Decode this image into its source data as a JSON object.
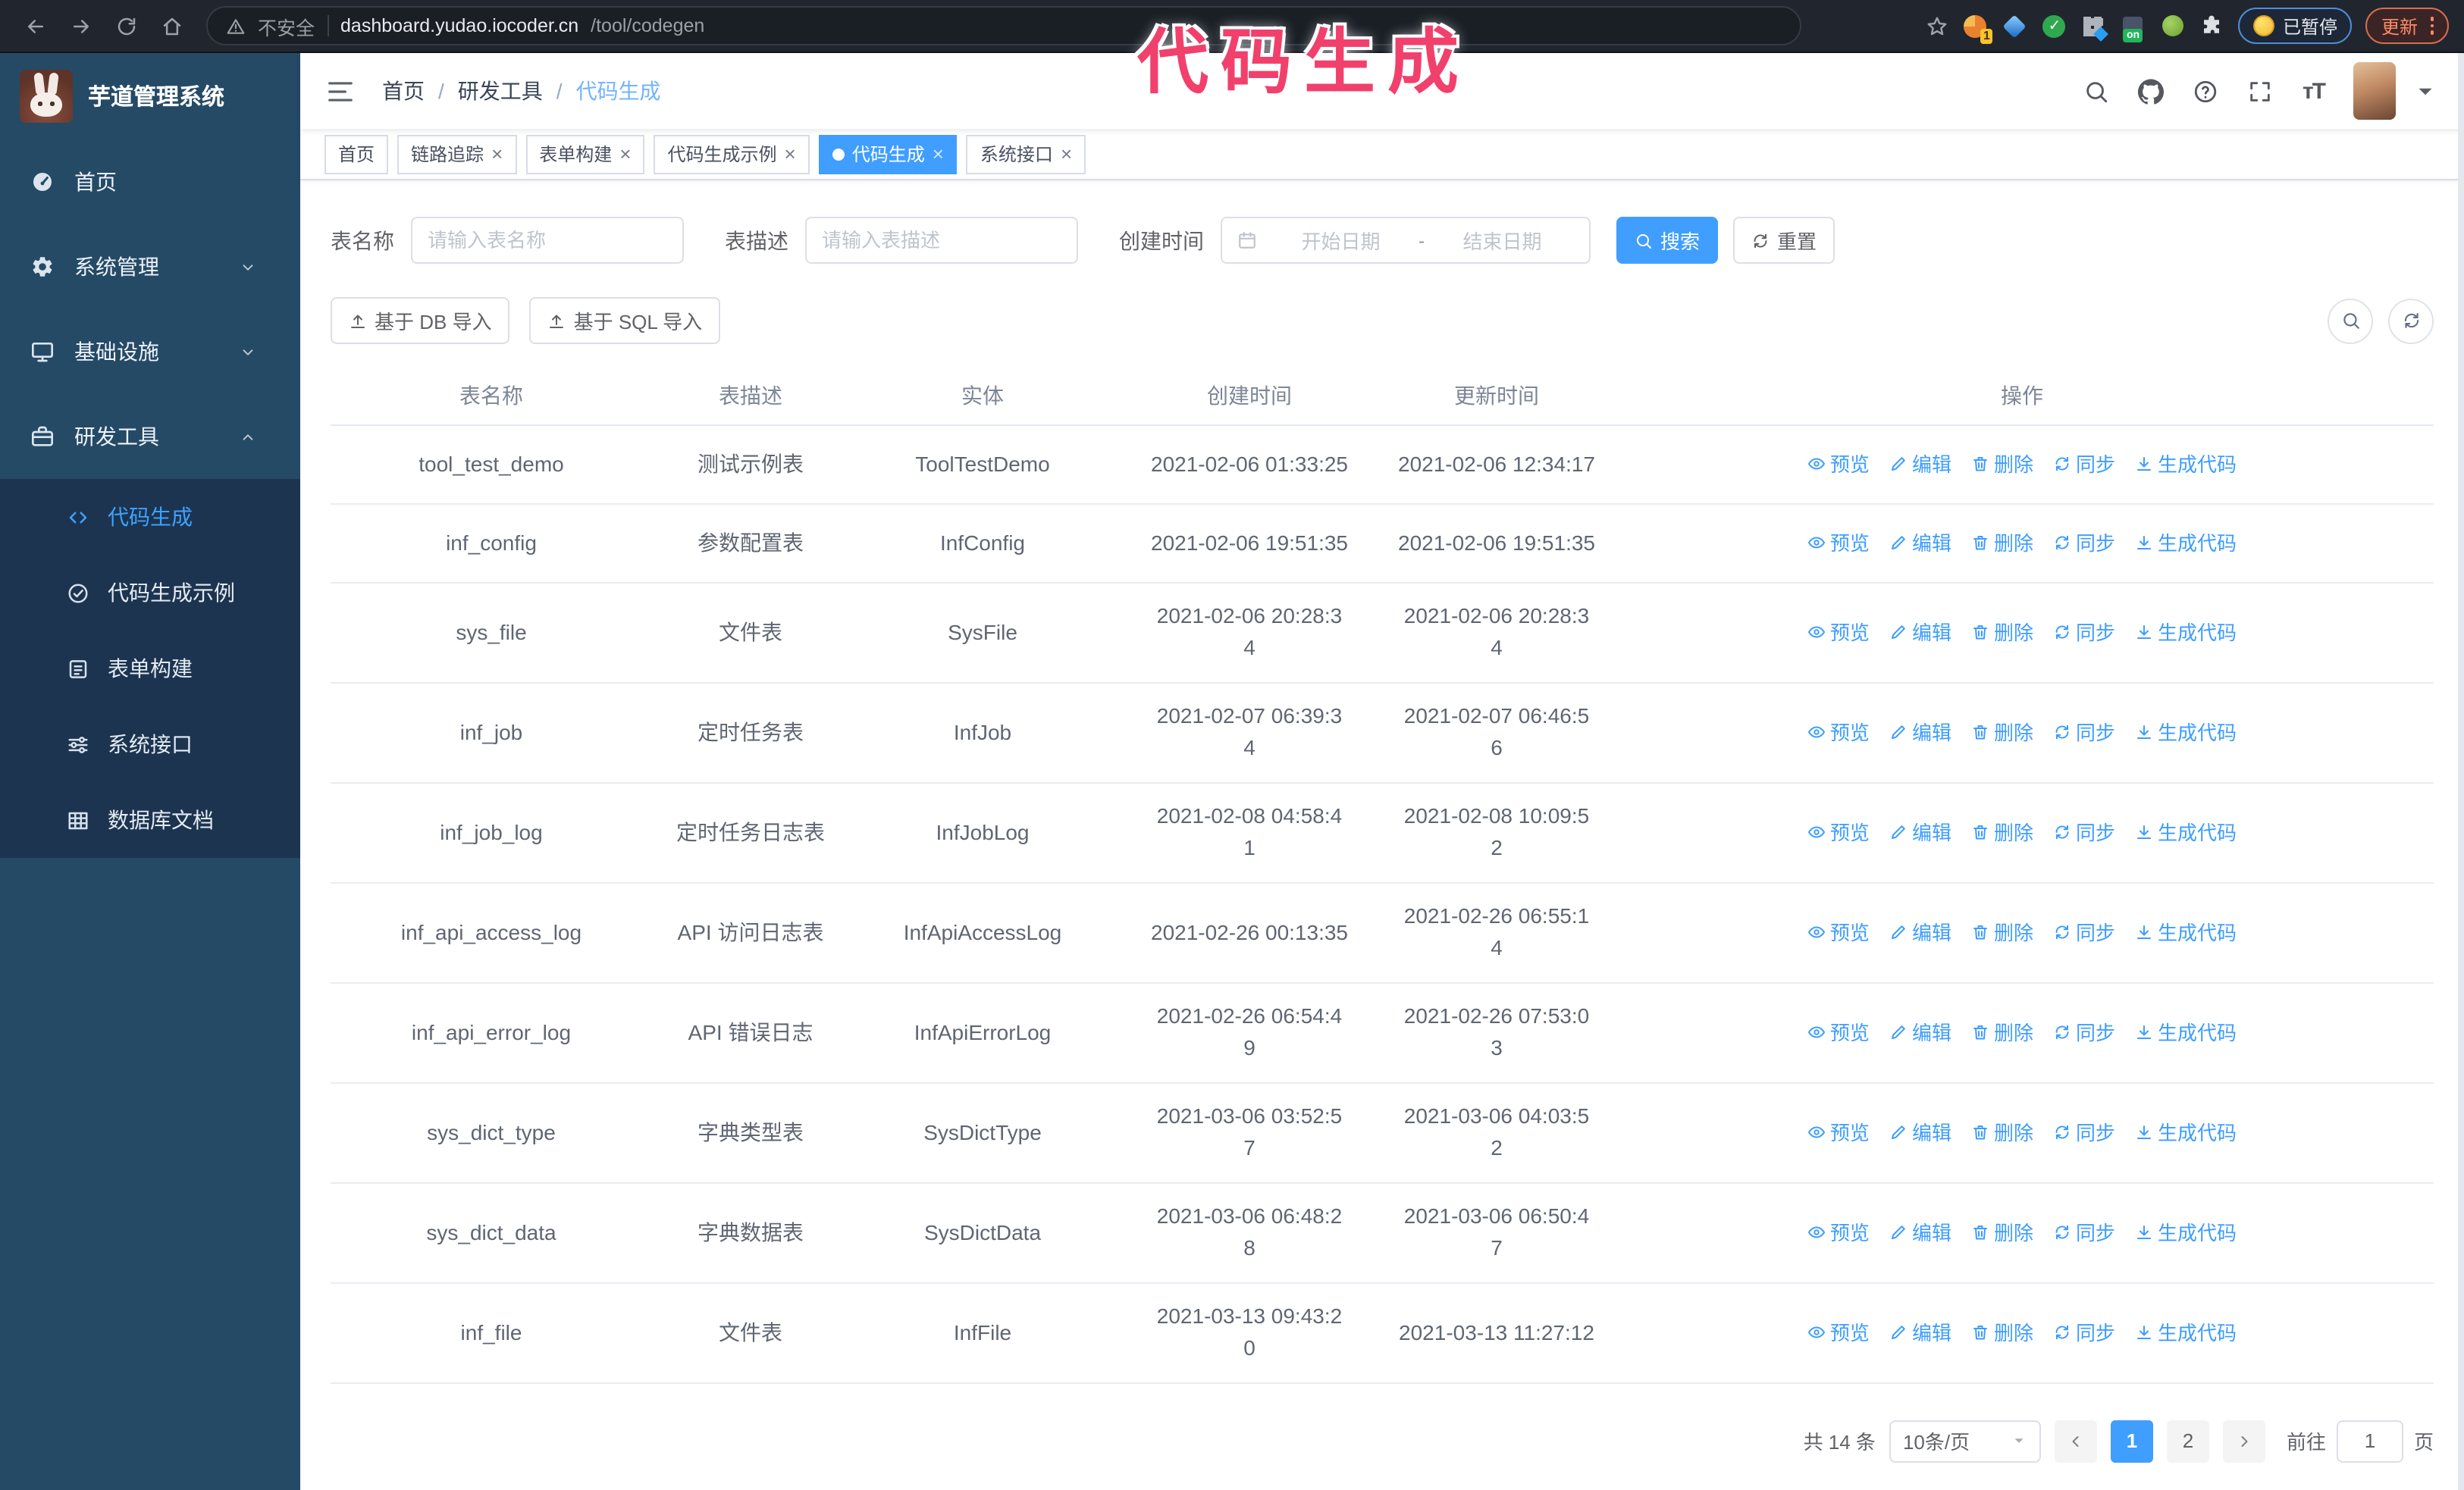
{
  "browser": {
    "security_label": "不安全",
    "url_host": "dashboard.yudao.iocoder.cn",
    "url_path": "/tool/codegen",
    "ext1_badge": "1",
    "ext_on_badge": "on",
    "profile_chip": "已暂停",
    "update_button": "更新"
  },
  "annotation": {
    "text": "代码生成",
    "color": "#f1406c"
  },
  "sidebar": {
    "logo_title": "芋道管理系统",
    "items": [
      {
        "key": "home",
        "label": "首页",
        "icon": "dashboard"
      },
      {
        "key": "system",
        "label": "系统管理",
        "icon": "gear",
        "chevron": "down"
      },
      {
        "key": "infra",
        "label": "基础设施",
        "icon": "monitor",
        "chevron": "down"
      },
      {
        "key": "devtools",
        "label": "研发工具",
        "icon": "case",
        "chevron": "up",
        "expanded": true
      }
    ],
    "submenu": [
      {
        "key": "codegen",
        "label": "代码生成",
        "icon": "code",
        "active": true
      },
      {
        "key": "codegen-example",
        "label": "代码生成示例",
        "icon": "check"
      },
      {
        "key": "form-builder",
        "label": "表单构建",
        "icon": "form"
      },
      {
        "key": "system-api",
        "label": "系统接口",
        "icon": "sliders"
      },
      {
        "key": "db-doc",
        "label": "数据库文档",
        "icon": "grid"
      }
    ]
  },
  "header": {
    "breadcrumb": [
      "首页",
      "研发工具",
      "代码生成"
    ]
  },
  "tabs": [
    {
      "key": "home",
      "label": "首页",
      "closable": false,
      "active": false
    },
    {
      "key": "trace",
      "label": "链路追踪",
      "closable": true,
      "active": false
    },
    {
      "key": "form-builder",
      "label": "表单构建",
      "closable": true,
      "active": false
    },
    {
      "key": "codegen-example",
      "label": "代码生成示例",
      "closable": true,
      "active": false
    },
    {
      "key": "codegen",
      "label": "代码生成",
      "closable": true,
      "active": true
    },
    {
      "key": "system-api",
      "label": "系统接口",
      "closable": true,
      "active": false
    }
  ],
  "filters": {
    "name_label": "表名称",
    "name_placeholder": "请输入表名称",
    "desc_label": "表描述",
    "desc_placeholder": "请输入表描述",
    "time_label": "创建时间",
    "start_placeholder": "开始日期",
    "range_separator": "-",
    "end_placeholder": "结束日期",
    "search_label": "搜索",
    "reset_label": "重置"
  },
  "toolbar": {
    "import_db": "基于 DB 导入",
    "import_sql": "基于 SQL 导入"
  },
  "table": {
    "columns": [
      "表名称",
      "表描述",
      "实体",
      "创建时间",
      "更新时间",
      "操作"
    ],
    "actions": [
      "预览",
      "编辑",
      "删除",
      "同步",
      "生成代码"
    ],
    "rows": [
      {
        "name": "tool_test_demo",
        "desc": "测试示例表",
        "entity": "ToolTestDemo",
        "created": "2021-02-06 01:33:25",
        "updated": "2021-02-06 12:34:17"
      },
      {
        "name": "inf_config",
        "desc": "参数配置表",
        "entity": "InfConfig",
        "created": "2021-02-06 19:51:35",
        "updated": "2021-02-06 19:51:35"
      },
      {
        "name": "sys_file",
        "desc": "文件表",
        "entity": "SysFile",
        "created": "2021-02-06 20:28:3\n4",
        "updated": "2021-02-06 20:28:3\n4"
      },
      {
        "name": "inf_job",
        "desc": "定时任务表",
        "entity": "InfJob",
        "created": "2021-02-07 06:39:3\n4",
        "updated": "2021-02-07 06:46:5\n6"
      },
      {
        "name": "inf_job_log",
        "desc": "定时任务日志表",
        "entity": "InfJobLog",
        "created": "2021-02-08 04:58:4\n1",
        "updated": "2021-02-08 10:09:5\n2"
      },
      {
        "name": "inf_api_access_log",
        "desc": "API 访问日志表",
        "entity": "InfApiAccessLog",
        "created": "2021-02-26 00:13:35",
        "updated": "2021-02-26 06:55:1\n4"
      },
      {
        "name": "inf_api_error_log",
        "desc": "API 错误日志",
        "entity": "InfApiErrorLog",
        "created": "2021-02-26 06:54:4\n9",
        "updated": "2021-02-26 07:53:0\n3"
      },
      {
        "name": "sys_dict_type",
        "desc": "字典类型表",
        "entity": "SysDictType",
        "created": "2021-03-06 03:52:5\n7",
        "updated": "2021-03-06 04:03:5\n2"
      },
      {
        "name": "sys_dict_data",
        "desc": "字典数据表",
        "entity": "SysDictData",
        "created": "2021-03-06 06:48:2\n8",
        "updated": "2021-03-06 06:50:4\n7"
      },
      {
        "name": "inf_file",
        "desc": "文件表",
        "entity": "InfFile",
        "created": "2021-03-13 09:43:2\n0",
        "updated": "2021-03-13 11:27:12"
      }
    ]
  },
  "pagination": {
    "total": "共 14 条",
    "page_size": "10条/页",
    "pages": [
      "1",
      "2"
    ],
    "active_page": "1",
    "goto_label": "前往",
    "goto_value": "1",
    "page_unit": "页"
  },
  "colors": {
    "accent": "#409eff",
    "sidebar_bg": "#254a66",
    "submenu_bg": "#1c3450",
    "annotation": "#f1406c"
  }
}
